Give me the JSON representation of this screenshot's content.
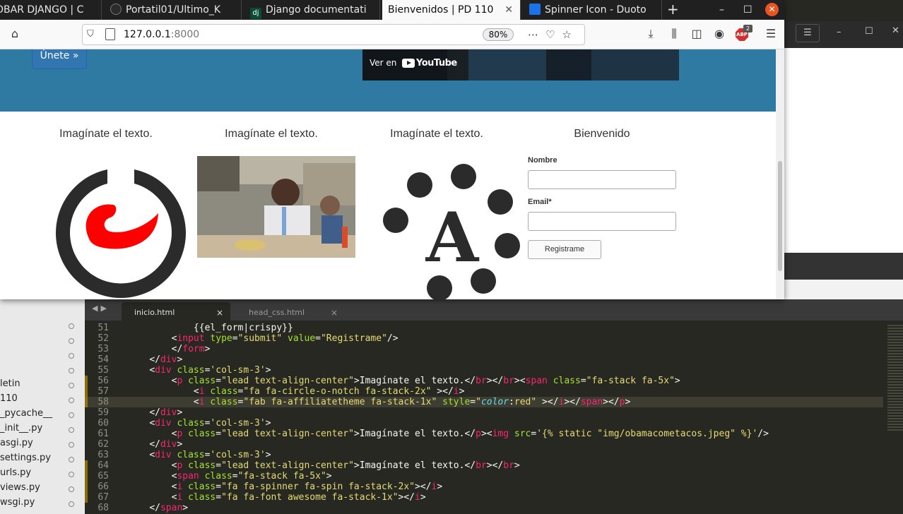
{
  "browser": {
    "tabs": [
      {
        "label": "OBAR DJANGO | C",
        "favicon_color": "#3a3a3a"
      },
      {
        "label": "Portatil01/Ultimo_K",
        "favicon_color": "#2b2b2b"
      },
      {
        "label": "Django documentati",
        "favicon_color": "#0c4b33"
      },
      {
        "label": "Bienvenidos | PD 110",
        "favicon_color": "#f9f9fa"
      },
      {
        "label": "Spinner Icon - Duoto",
        "favicon_color": "#1a73e8"
      }
    ],
    "active_tab_index": 3,
    "new_tab_icon": "plus-icon",
    "url_host": "127.0.0.1",
    "url_port": ":8000",
    "zoom": "80%",
    "abp_label": "ABP",
    "abp_count": "2"
  },
  "page": {
    "join_button": "Únete »",
    "video": {
      "watch_on": "Ver en",
      "brand": "YouTube"
    },
    "columns": [
      {
        "heading": "Imagínate el texto."
      },
      {
        "heading": "Imagínate el texto."
      },
      {
        "heading": "Imagínate el texto."
      },
      {
        "heading": "Bienvenido"
      }
    ],
    "form": {
      "name_label": "Nombre",
      "email_label": "Email*",
      "submit_label": "Registrame"
    },
    "icon_colors": {
      "ring": "#2b2b2b",
      "logo": "#ff0000",
      "accent": "#2f7aa3"
    }
  },
  "editor": {
    "tabs": [
      {
        "label": "inicio.html",
        "close": "×"
      },
      {
        "label": "head_css.html",
        "close": "×"
      }
    ],
    "sidebar_items": [
      "letin",
      "110",
      "_pycache__",
      "_init__.py",
      "asgi.py",
      "settings.py",
      "urls.py",
      "views.py",
      "wsgi.py"
    ],
    "lines": [
      {
        "n": "51",
        "indent": "            ",
        "parts": [
          {
            "c": "t-plain",
            "t": "{{el_form|crispy}}"
          }
        ]
      },
      {
        "n": "52",
        "indent": "        ",
        "parts": [
          {
            "c": "t-plain",
            "t": "<"
          },
          {
            "c": "t-tag",
            "t": "input"
          },
          {
            "c": "t-attr",
            "t": " type"
          },
          {
            "c": "t-plain",
            "t": "="
          },
          {
            "c": "t-str",
            "t": "\"submit\""
          },
          {
            "c": "t-attr",
            "t": " value"
          },
          {
            "c": "t-plain",
            "t": "="
          },
          {
            "c": "t-str",
            "t": "\"Registrame\""
          },
          {
            "c": "t-plain",
            "t": "/>"
          }
        ]
      },
      {
        "n": "53",
        "indent": "        ",
        "parts": [
          {
            "c": "t-plain",
            "t": "</"
          },
          {
            "c": "t-tag",
            "t": "form"
          },
          {
            "c": "t-plain",
            "t": ">"
          }
        ]
      },
      {
        "n": "54",
        "indent": "    ",
        "parts": [
          {
            "c": "t-plain",
            "t": "</"
          },
          {
            "c": "t-tag",
            "t": "div"
          },
          {
            "c": "t-plain",
            "t": ">"
          }
        ]
      },
      {
        "n": "55",
        "indent": "    ",
        "parts": [
          {
            "c": "t-plain",
            "t": "<"
          },
          {
            "c": "t-tag",
            "t": "div"
          },
          {
            "c": "t-attr",
            "t": " class"
          },
          {
            "c": "t-plain",
            "t": "="
          },
          {
            "c": "t-str",
            "t": "'col-sm-3'"
          },
          {
            "c": "t-plain",
            "t": ">"
          }
        ]
      },
      {
        "n": "56",
        "indent": "        ",
        "parts": [
          {
            "c": "t-plain",
            "t": "<"
          },
          {
            "c": "t-tag",
            "t": "p"
          },
          {
            "c": "t-attr",
            "t": " class"
          },
          {
            "c": "t-plain",
            "t": "="
          },
          {
            "c": "t-str",
            "t": "\"lead text-align-center\""
          },
          {
            "c": "t-plain",
            "t": ">Imagínate el texto.</"
          },
          {
            "c": "t-tag",
            "t": "br"
          },
          {
            "c": "t-plain",
            "t": "></"
          },
          {
            "c": "t-tag",
            "t": "br"
          },
          {
            "c": "t-plain",
            "t": "><"
          },
          {
            "c": "t-tag",
            "t": "span"
          },
          {
            "c": "t-attr",
            "t": " class"
          },
          {
            "c": "t-plain",
            "t": "="
          },
          {
            "c": "t-str",
            "t": "\"fa-stack fa-5x\""
          },
          {
            "c": "t-plain",
            "t": ">"
          }
        ]
      },
      {
        "n": "57",
        "indent": "            ",
        "parts": [
          {
            "c": "t-plain",
            "t": "<"
          },
          {
            "c": "t-tag",
            "t": "i"
          },
          {
            "c": "t-attr",
            "t": " class"
          },
          {
            "c": "t-plain",
            "t": "="
          },
          {
            "c": "t-str",
            "t": "\"fa fa-circle-o-notch fa-stack-2x\""
          },
          {
            "c": "t-plain",
            "t": " ></"
          },
          {
            "c": "t-tag",
            "t": "i"
          },
          {
            "c": "t-plain",
            "t": ">"
          }
        ]
      },
      {
        "n": "58",
        "indent": "            ",
        "hl": true,
        "parts": [
          {
            "c": "t-plain",
            "t": "<"
          },
          {
            "c": "t-tag",
            "t": "i"
          },
          {
            "c": "t-attr",
            "t": " class"
          },
          {
            "c": "t-plain",
            "t": "="
          },
          {
            "c": "t-str",
            "t": "\"fab fa-affiliatetheme fa-stack-1x\""
          },
          {
            "c": "t-attr",
            "t": " style"
          },
          {
            "c": "t-plain",
            "t": "="
          },
          {
            "c": "t-str",
            "t": "\""
          },
          {
            "c": "t-prop",
            "t": "color"
          },
          {
            "c": "t-plain",
            "t": ":"
          },
          {
            "c": "t-str",
            "t": "red\""
          },
          {
            "c": "t-plain",
            "t": " ></"
          },
          {
            "c": "t-tag",
            "t": "i"
          },
          {
            "c": "t-plain",
            "t": "></"
          },
          {
            "c": "t-tag",
            "t": "span"
          },
          {
            "c": "t-plain",
            "t": "></"
          },
          {
            "c": "t-tag",
            "t": "p"
          },
          {
            "c": "t-plain",
            "t": ">"
          }
        ]
      },
      {
        "n": "59",
        "indent": "    ",
        "parts": [
          {
            "c": "t-plain",
            "t": "</"
          },
          {
            "c": "t-tag",
            "t": "div"
          },
          {
            "c": "t-plain",
            "t": ">"
          }
        ]
      },
      {
        "n": "60",
        "indent": "    ",
        "parts": [
          {
            "c": "t-plain",
            "t": "<"
          },
          {
            "c": "t-tag",
            "t": "div"
          },
          {
            "c": "t-attr",
            "t": " class"
          },
          {
            "c": "t-plain",
            "t": "="
          },
          {
            "c": "t-str",
            "t": "'col-sm-3'"
          },
          {
            "c": "t-plain",
            "t": ">"
          }
        ]
      },
      {
        "n": "61",
        "indent": "        ",
        "parts": [
          {
            "c": "t-plain",
            "t": "<"
          },
          {
            "c": "t-tag",
            "t": "p"
          },
          {
            "c": "t-attr",
            "t": " class"
          },
          {
            "c": "t-plain",
            "t": "="
          },
          {
            "c": "t-str",
            "t": "\"lead text-align-center\""
          },
          {
            "c": "t-plain",
            "t": ">Imagínate el texto.</"
          },
          {
            "c": "t-tag",
            "t": "p"
          },
          {
            "c": "t-plain",
            "t": "><"
          },
          {
            "c": "t-tag",
            "t": "img"
          },
          {
            "c": "t-attr",
            "t": " src"
          },
          {
            "c": "t-plain",
            "t": "="
          },
          {
            "c": "t-str",
            "t": "'{% static \"img/obamacometacos.jpeg\" %}'"
          },
          {
            "c": "t-plain",
            "t": "/>"
          }
        ]
      },
      {
        "n": "62",
        "indent": "    ",
        "parts": [
          {
            "c": "t-plain",
            "t": "</"
          },
          {
            "c": "t-tag",
            "t": "div"
          },
          {
            "c": "t-plain",
            "t": ">"
          }
        ]
      },
      {
        "n": "63",
        "indent": "    ",
        "parts": [
          {
            "c": "t-plain",
            "t": "<"
          },
          {
            "c": "t-tag",
            "t": "div"
          },
          {
            "c": "t-attr",
            "t": " class"
          },
          {
            "c": "t-plain",
            "t": "="
          },
          {
            "c": "t-str",
            "t": "'col-sm-3'"
          },
          {
            "c": "t-plain",
            "t": ">"
          }
        ]
      },
      {
        "n": "64",
        "indent": "        ",
        "parts": [
          {
            "c": "t-plain",
            "t": "<"
          },
          {
            "c": "t-tag",
            "t": "p"
          },
          {
            "c": "t-attr",
            "t": " class"
          },
          {
            "c": "t-plain",
            "t": "="
          },
          {
            "c": "t-str",
            "t": "\"lead text-align-center\""
          },
          {
            "c": "t-plain",
            "t": ">Imagínate el texto.</"
          },
          {
            "c": "t-tag",
            "t": "br"
          },
          {
            "c": "t-plain",
            "t": "></"
          },
          {
            "c": "t-tag",
            "t": "br"
          },
          {
            "c": "t-plain",
            "t": ">"
          }
        ]
      },
      {
        "n": "65",
        "indent": "        ",
        "parts": [
          {
            "c": "t-plain",
            "t": "<"
          },
          {
            "c": "t-tag",
            "t": "span"
          },
          {
            "c": "t-attr",
            "t": " class"
          },
          {
            "c": "t-plain",
            "t": "="
          },
          {
            "c": "t-str",
            "t": "\"fa-stack fa-5x\""
          },
          {
            "c": "t-plain",
            "t": ">"
          }
        ]
      },
      {
        "n": "66",
        "indent": "        ",
        "parts": [
          {
            "c": "t-plain",
            "t": "<"
          },
          {
            "c": "t-tag",
            "t": "i"
          },
          {
            "c": "t-attr",
            "t": " class"
          },
          {
            "c": "t-plain",
            "t": "="
          },
          {
            "c": "t-str",
            "t": "\"fa fa-spinner fa-spin fa-stack-2x\""
          },
          {
            "c": "t-plain",
            "t": "></"
          },
          {
            "c": "t-tag",
            "t": "i"
          },
          {
            "c": "t-plain",
            "t": ">"
          }
        ]
      },
      {
        "n": "67",
        "indent": "        ",
        "parts": [
          {
            "c": "t-plain",
            "t": "<"
          },
          {
            "c": "t-tag",
            "t": "i"
          },
          {
            "c": "t-attr",
            "t": " class"
          },
          {
            "c": "t-plain",
            "t": "="
          },
          {
            "c": "t-str",
            "t": "\"fa fa-font awesome fa-stack-1x\""
          },
          {
            "c": "t-plain",
            "t": "></"
          },
          {
            "c": "t-tag",
            "t": "i"
          },
          {
            "c": "t-plain",
            "t": ">"
          }
        ]
      },
      {
        "n": "68",
        "indent": "    ",
        "parts": [
          {
            "c": "t-plain",
            "t": "</"
          },
          {
            "c": "t-tag",
            "t": "span"
          },
          {
            "c": "t-plain",
            "t": ">"
          }
        ]
      }
    ],
    "modified_lines": [
      "56",
      "57",
      "58",
      "64",
      "65",
      "66",
      "67"
    ]
  }
}
